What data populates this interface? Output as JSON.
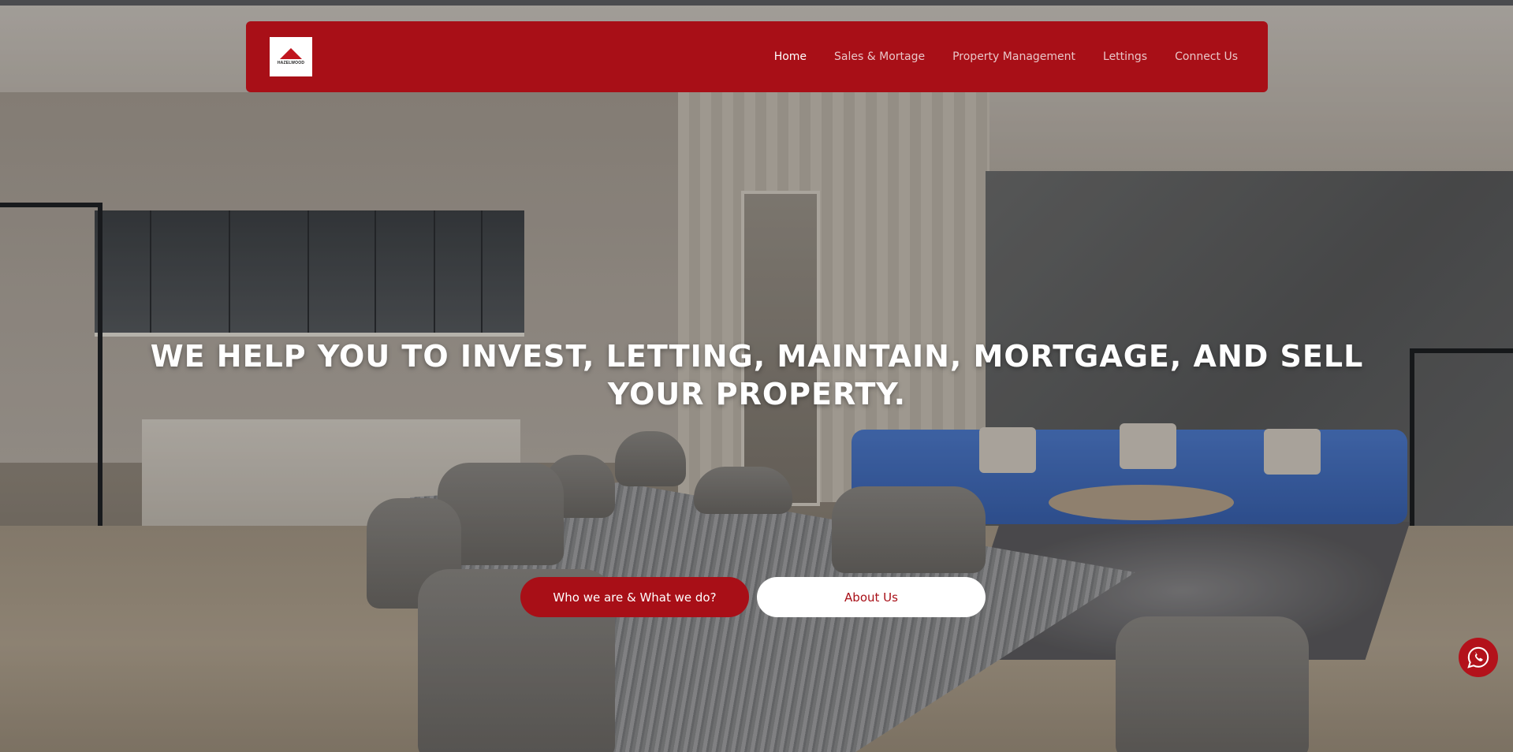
{
  "nav": {
    "logo_text": "HAZELWOOD",
    "items": [
      {
        "label": "Home",
        "active": true
      },
      {
        "label": "Sales & Mortage",
        "active": false
      },
      {
        "label": "Property Management",
        "active": false
      },
      {
        "label": "Lettings",
        "active": false
      },
      {
        "label": "Connect Us",
        "active": false
      }
    ]
  },
  "hero": {
    "headline_line1": "WE HELP YOU TO INVEST, LETTING, MAINTAIN, MORTGAGE, AND SELL",
    "headline_line2": "YOUR PROPERTY.",
    "primary_button": "Who we are & What we do?",
    "secondary_button": "About Us"
  },
  "floating": {
    "whatsapp_icon": "whatsapp-icon"
  },
  "colors": {
    "brand_red": "#a80f17",
    "white": "#ffffff"
  }
}
